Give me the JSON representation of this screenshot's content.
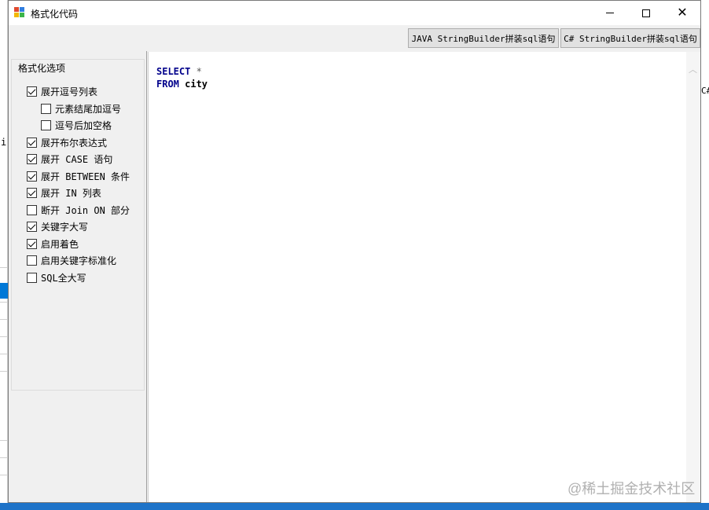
{
  "window": {
    "title": "格式化代码",
    "controls": {
      "minimize": "—",
      "maximize": "☐",
      "close": "✕"
    }
  },
  "toolbar": {
    "java_button": "JAVA StringBuilder拼装sql语句",
    "csharp_button": "C# StringBuilder拼装sql语句"
  },
  "options": {
    "group_title": "格式化选项",
    "items": [
      {
        "label": "展开逗号列表",
        "checked": true
      },
      {
        "label": "元素结尾加逗号",
        "checked": false
      },
      {
        "label": "逗号后加空格",
        "checked": false
      },
      {
        "label": "展开布尔表达式",
        "checked": true
      },
      {
        "label": "展开 CASE 语句",
        "checked": true
      },
      {
        "label": "展开 BETWEEN 条件",
        "checked": true
      },
      {
        "label": "展开 IN 列表",
        "checked": true
      },
      {
        "label": "断开 Join ON 部分",
        "checked": false
      },
      {
        "label": "关键字大写",
        "checked": true
      },
      {
        "label": "启用着色",
        "checked": true
      },
      {
        "label": "启用关键字标准化",
        "checked": false
      },
      {
        "label": "SQL全大写",
        "checked": false
      }
    ]
  },
  "editor": {
    "line1_keyword": "SELECT",
    "line1_rest": " *",
    "line2_keyword": "FROM",
    "line2_rest": " city"
  },
  "background": {
    "left_glyph": "i",
    "right_glyph": "C#"
  },
  "watermark": "@稀土掘金技术社区",
  "colors": {
    "keyword": "#00008b",
    "taskbar": "#1e73c8",
    "window_bg": "#f0f0f0"
  }
}
